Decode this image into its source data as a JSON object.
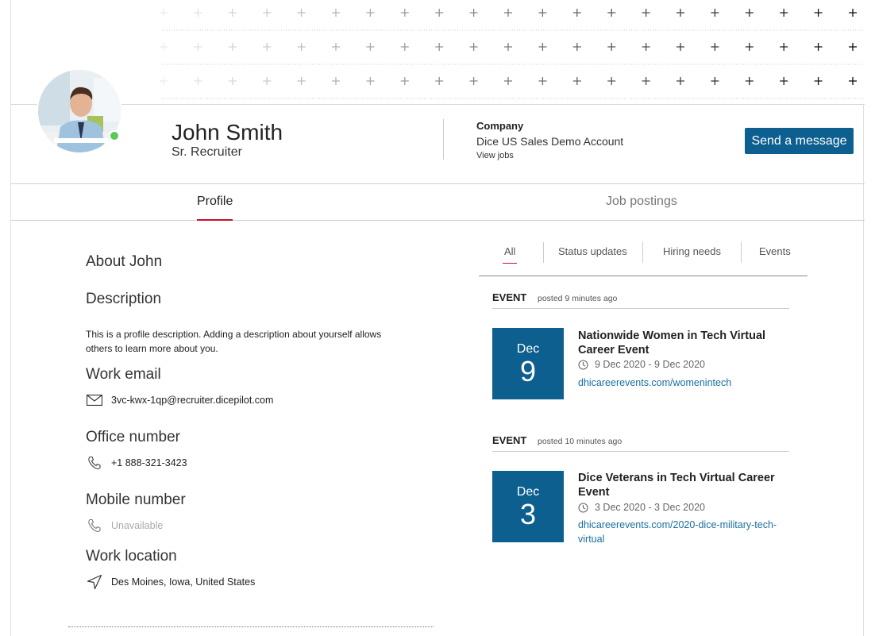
{
  "profile": {
    "name": "John Smith",
    "title": "Sr. Recruiter",
    "online_status_color": "#5cc85c"
  },
  "company": {
    "label": "Company",
    "name": "Dice US Sales Demo Account",
    "view_jobs": "View jobs"
  },
  "actions": {
    "send_message": "Send a message"
  },
  "tabs": [
    {
      "label": "Profile",
      "active": true
    },
    {
      "label": "Job postings",
      "active": false
    }
  ],
  "about": {
    "heading": "About John",
    "description_heading": "Description",
    "description_text": "This is a profile description. Adding a description about yourself allows others to learn more about you.",
    "work_email_heading": "Work email",
    "work_email": "3vc-kwx-1qp@recruiter.dicepilot.com",
    "office_heading": "Office number",
    "office_number": "+1 888-321-3423",
    "mobile_heading": "Mobile number",
    "mobile_number": "Unavailable",
    "location_heading": "Work location",
    "location": "Des Moines, Iowa, United States"
  },
  "filters": [
    {
      "label": "All",
      "active": true
    },
    {
      "label": "Status updates",
      "active": false
    },
    {
      "label": "Hiring needs",
      "active": false
    },
    {
      "label": "Events",
      "active": false
    }
  ],
  "events": [
    {
      "tag": "EVENT",
      "posted": "posted 9 minutes ago",
      "month": "Dec",
      "day": "9",
      "title": "Nationwide Women in Tech Virtual Career Event",
      "dates": "9 Dec 2020 - 9 Dec 2020",
      "link": "dhicareerevents.com/womenintech"
    },
    {
      "tag": "EVENT",
      "posted": "posted 10 minutes ago",
      "month": "Dec",
      "day": "3",
      "title": "Dice Veterans in Tech Virtual Career Event",
      "dates": "3 Dec 2020 - 3 Dec 2020",
      "link": "dhicareerevents.com/2020-dice-military-tech-virtual"
    }
  ],
  "colors": {
    "brand_blue": "#0c5f8e",
    "accent_red": "#c8102e",
    "link_blue": "#1a6fa0"
  }
}
